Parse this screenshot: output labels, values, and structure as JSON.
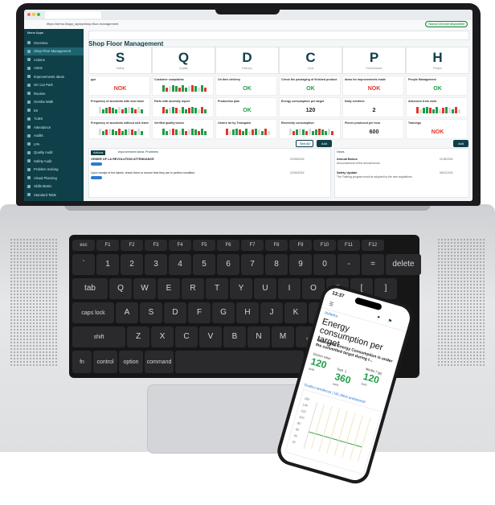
{
  "browser": {
    "url": "https://demo.it/app_sqdcp/shop-floor-management",
    "profile_button": "Nuova Chrome disponibile"
  },
  "app": {
    "title": "Shop Floor Management",
    "sidebar": {
      "brand": "Menu Apps",
      "items": [
        "Overview",
        "Shop Floor Management",
        "Actions",
        "Alerts",
        "Improvements Ideas",
        "GK Car Park",
        "Routine",
        "Gemba Walk",
        "5S",
        "TLMS",
        "Attendance",
        "Audits",
        "LPA",
        "Quality Audit",
        "Safety Audit",
        "Problem Solving",
        "Visual Planning",
        "Skills Matrix",
        "Standard Table"
      ]
    },
    "letters": [
      {
        "letter": "S",
        "sub": "Safety"
      },
      {
        "letter": "Q",
        "sub": "Quality"
      },
      {
        "letter": "D",
        "sub": "Delivery"
      },
      {
        "letter": "C",
        "sub": "Cost"
      },
      {
        "letter": "P",
        "sub": "Performance"
      },
      {
        "letter": "H",
        "sub": "People"
      }
    ],
    "rows": [
      [
        {
          "title": "ppe",
          "value": "NOK",
          "status": "nok"
        },
        {
          "title": "Customer complaints",
          "value": "",
          "status": "bars"
        },
        {
          "title": "On time delivery",
          "value": "OK",
          "status": "ok"
        },
        {
          "title": "Check the packaging of finished product",
          "value": "OK",
          "status": "ok"
        },
        {
          "title": "Ideas for improvements made",
          "value": "NOK",
          "status": "nok"
        },
        {
          "title": "People Management",
          "value": "OK",
          "status": "ok"
        }
      ],
      [
        {
          "title": "Frequency of accidents with sick leave",
          "value": "",
          "status": "bars"
        },
        {
          "title": "Parts with anomaly report",
          "value": "",
          "status": "bars"
        },
        {
          "title": "Production plan",
          "value": "OK",
          "status": "ok"
        },
        {
          "title": "Energy consumption per target",
          "value": "120",
          "status": "num"
        },
        {
          "title": "Daily overtime",
          "value": "2",
          "status": "num"
        },
        {
          "title": "Absences from work",
          "value": "",
          "status": "bars"
        }
      ],
      [
        {
          "title": "Frequency of accidents without sick leave",
          "value": "",
          "status": "bars"
        },
        {
          "title": "Verified quality boxes",
          "value": "",
          "status": "bars"
        },
        {
          "title": "Orders lar by Transpack",
          "value": "",
          "status": "bars"
        },
        {
          "title": "Electricity consumption",
          "value": "",
          "status": "bars"
        },
        {
          "title": "Pieces produced per hour",
          "value": "600",
          "status": "num"
        },
        {
          "title": "Trainings",
          "value": "NOK",
          "status": "nok"
        }
      ]
    ],
    "tabs": [
      "Actions",
      "Improvement Ideas",
      "Problems"
    ],
    "see_all": "See All",
    "add": "Add",
    "news_tab": "News",
    "lists": [
      {
        "title": "ORDER OF LA REVOLUTION ATTENDANCE",
        "date": "22/05/2024"
      },
      {
        "title": "Upon receipt of the labels, check them to ensure that they are in perfect condition.",
        "date": "22/05/2024"
      }
    ],
    "news": [
      {
        "title": "Annual Bonus",
        "text": "Announcement of the annual bonus.",
        "date": "21/05/2024"
      },
      {
        "title": "Safety Update",
        "text": "The Training program must be adopted by the new regulations.",
        "date": "08/12/2023"
      }
    ]
  },
  "keyboard": {
    "fn_row": [
      "esc",
      "F1",
      "F2",
      "F3",
      "F4",
      "F5",
      "F6",
      "F7",
      "F8",
      "F9",
      "F10",
      "F11",
      "F12"
    ],
    "num_row": [
      "`",
      "1",
      "2",
      "3",
      "4",
      "5",
      "6",
      "7",
      "8",
      "9",
      "0",
      "-",
      "=",
      "delete"
    ],
    "q_row": [
      "tab",
      "Q",
      "W",
      "E",
      "R",
      "T",
      "Y",
      "U",
      "I",
      "O",
      "P",
      "[",
      "]"
    ],
    "a_row": [
      "caps lock",
      "A",
      "S",
      "D",
      "F",
      "G",
      "H",
      "J",
      "K",
      "L",
      ";",
      "'"
    ],
    "z_row": [
      "shift",
      "Z",
      "X",
      "C",
      "V",
      "B",
      "N",
      "M",
      ",",
      ".",
      "/"
    ],
    "bottom_row": [
      "fn",
      "control",
      "option",
      "command",
      "",
      "command",
      "option"
    ]
  },
  "phone": {
    "time": "13:37",
    "back": "Indietro",
    "heading": "Energy consumption per target",
    "question": "Guarantee Energy Consumption is under the committed target during t...",
    "stats": [
      {
        "label": "Giorno valor",
        "value": "120",
        "unit": "kwh"
      },
      {
        "label": "Sett. 1",
        "value": "360",
        "unit": "kwh"
      },
      {
        "label": "Media 7 gg",
        "value": "120",
        "unit": "kwh"
      }
    ],
    "chart_title": "Grafico tendenze | Gli ultimi andamenti",
    "y_ticks": [
      "160",
      "140",
      "120",
      "100",
      "80",
      "60",
      "40",
      "20"
    ]
  }
}
